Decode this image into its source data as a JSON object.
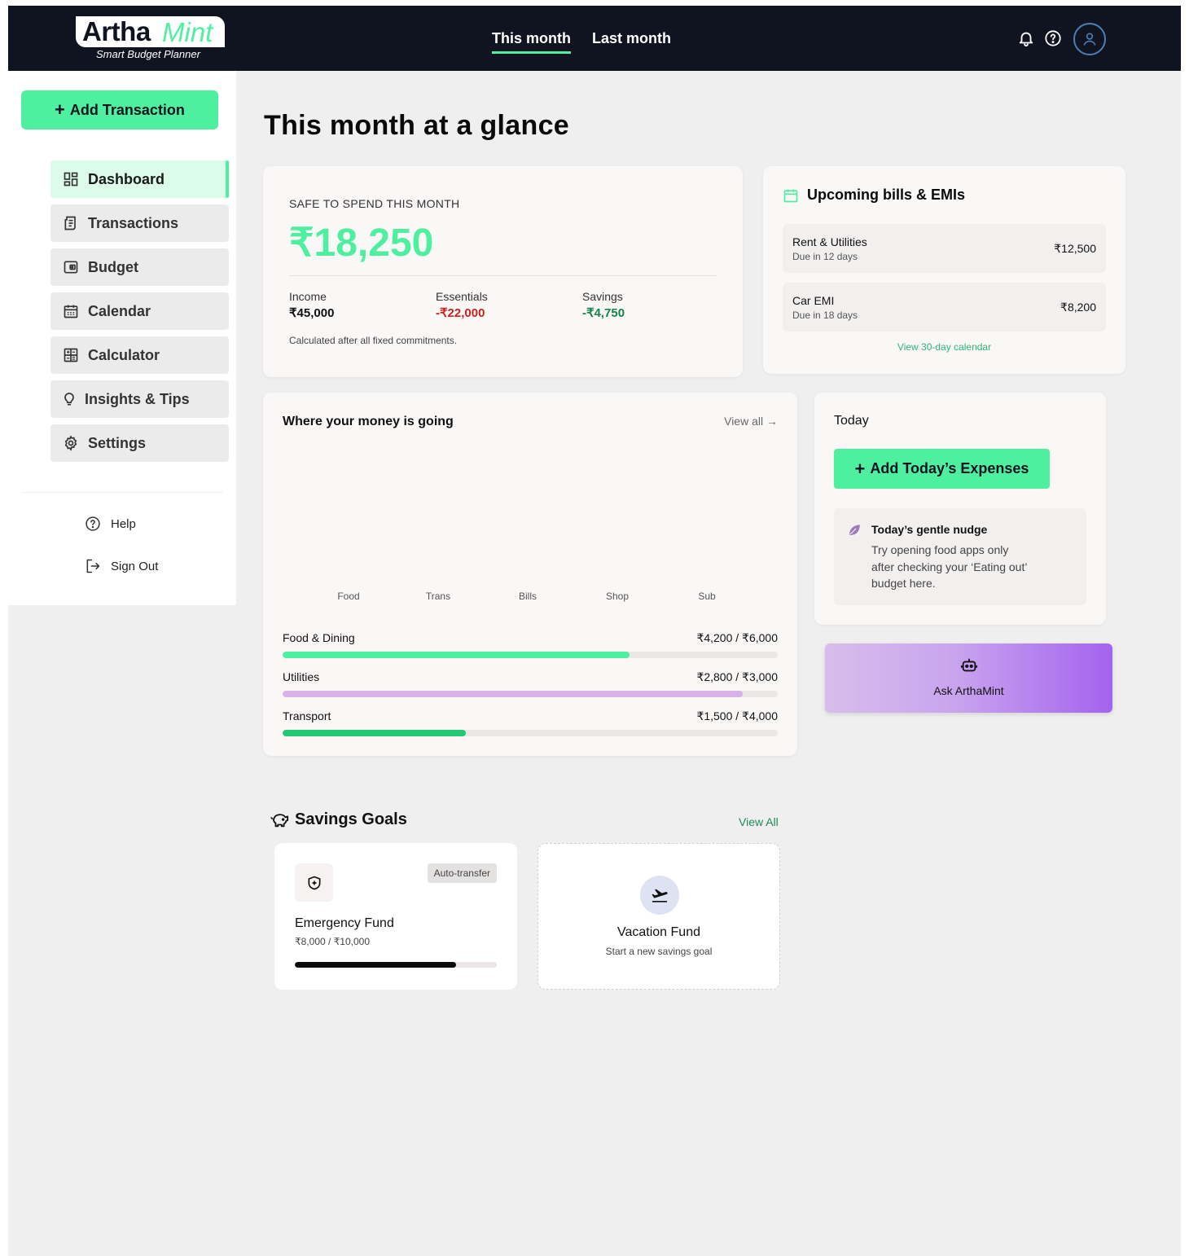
{
  "app": {
    "logo_part1": "Artha",
    "logo_part2": "Mint",
    "tagline": "Smart Budget Planner"
  },
  "header": {
    "tabs": [
      {
        "label": "This month",
        "active": true
      },
      {
        "label": "Last month",
        "active": false
      }
    ],
    "icons": [
      "bell-icon",
      "help-icon",
      "user-icon"
    ]
  },
  "sidebar": {
    "add_button": "Add Transaction",
    "items": [
      {
        "label": "Dashboard",
        "icon": "dashboard-icon",
        "active": true
      },
      {
        "label": "Transactions",
        "icon": "receipt-icon"
      },
      {
        "label": "Budget",
        "icon": "wallet-icon"
      },
      {
        "label": "Calendar",
        "icon": "calendar-icon"
      },
      {
        "label": "Calculator",
        "icon": "calculator-icon"
      },
      {
        "label": "Insights & Tips",
        "icon": "lightbulb-icon"
      },
      {
        "label": "Settings",
        "icon": "gear-icon"
      }
    ],
    "help": "Help",
    "signout": "Sign Out"
  },
  "main": {
    "title": "This month at a glance",
    "safe": {
      "label": "SAFE TO SPEND THIS MONTH",
      "amount": "₹18,250",
      "income_label": "Income",
      "income": "₹45,000",
      "essentials_label": "Essentials",
      "essentials": "-₹22,000",
      "savings_label": "Savings",
      "savings": "-₹4,750",
      "note": "Calculated after all fixed commitments."
    },
    "bills": {
      "title": "Upcoming bills & EMIs",
      "items": [
        {
          "name": "Rent & Utilities",
          "due": "Due in 12 days",
          "amount": "₹12,500"
        },
        {
          "name": "Car EMI",
          "due": "Due in 18 days",
          "amount": "₹8,200"
        }
      ],
      "link": "View 30-day calendar"
    },
    "money": {
      "title": "Where your money is going",
      "view_all": "View all →",
      "categories": [
        {
          "name": "Food & Dining",
          "amount": "₹4,200 / ₹6,000",
          "ratio": 0.7,
          "color": "#4ef0a0"
        },
        {
          "name": "Utilities",
          "amount": "₹2,800 / ₹3,000",
          "ratio": 0.93,
          "color": "#d7b2e9"
        },
        {
          "name": "Transport",
          "amount": "₹1,500 / ₹4,000",
          "ratio": 0.37,
          "color": "#22c874"
        }
      ]
    },
    "today": {
      "title": "Today",
      "button": "Add Today’s Expenses",
      "nudge_title": "Today’s gentle nudge",
      "nudge_body": "Try opening food apps only after checking your ‘Eating out’ budget here."
    },
    "ask": {
      "label": "Ask ArthaMint"
    },
    "savings_goals": {
      "title": "Savings Goals",
      "view_all": "View All",
      "goals": [
        {
          "name": "Emergency Fund",
          "amount": "₹8,000 / ₹10,000",
          "badge": "Auto-transfer",
          "progress": 0.8
        },
        {
          "name": "Vacation Fund",
          "subtitle": "Start a new savings goal"
        }
      ]
    }
  },
  "chart_data": {
    "type": "bar",
    "categories": [
      "Food",
      "Trans",
      "Bills",
      "Shop",
      "Sub"
    ],
    "values": [],
    "title": "",
    "xlabel": "",
    "ylabel": ""
  },
  "colors": {
    "accent": "#4ef0a0",
    "header_bg": "#0f1420",
    "negative": "#d01f1f",
    "positive": "#13854a"
  }
}
